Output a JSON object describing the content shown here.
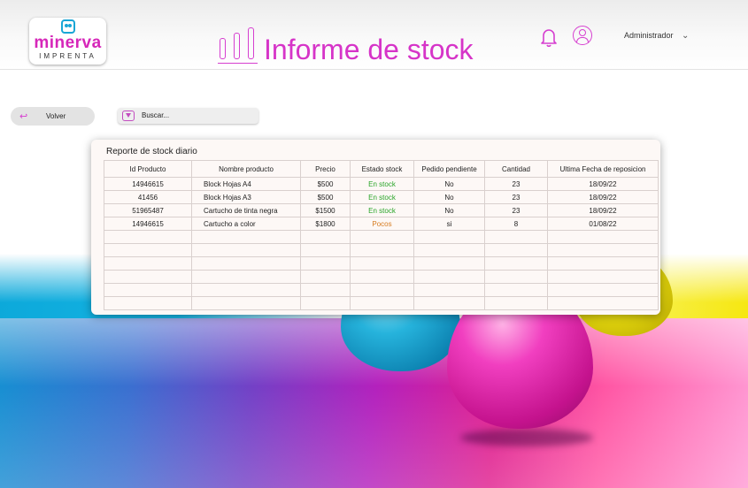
{
  "header": {
    "logo": {
      "brand": "minerva",
      "sub": "IMPRENTA"
    },
    "title": "Informe de stock",
    "user": "Administrador",
    "icons": {
      "bell": "bell-icon",
      "user": "user-icon",
      "chevron": "chevron-down-icon",
      "report": "bar-chart-icon"
    }
  },
  "controls": {
    "back_label": "Volver",
    "search_placeholder": "Buscar..."
  },
  "report": {
    "heading": "Reporte de stock diario",
    "columns": [
      "Id Producto",
      "Nombre producto",
      "Precio",
      "Estado stock",
      "Pedido pendiente",
      "Cantidad",
      "Ultima Fecha de reposicion"
    ],
    "rows": [
      [
        "14946615",
        "Block Hojas A4",
        "$500",
        "En stock",
        "No",
        "23",
        "18/09/22"
      ],
      [
        "41456",
        "Block Hojas A3",
        "$500",
        "En stock",
        "No",
        "23",
        "18/09/22"
      ],
      [
        "51965487",
        "Cartucho de tinta negra",
        "$1500",
        "En stock",
        "No",
        "23",
        "18/09/22"
      ],
      [
        "14946615",
        "Cartucho a color",
        "$1800",
        "Pocos",
        "si",
        "8",
        "01/08/22"
      ]
    ],
    "empty_rows": 6
  },
  "colors": {
    "accent": "#d634c8",
    "in_stock": "#2aa52a",
    "low_stock": "#d67b1f"
  }
}
